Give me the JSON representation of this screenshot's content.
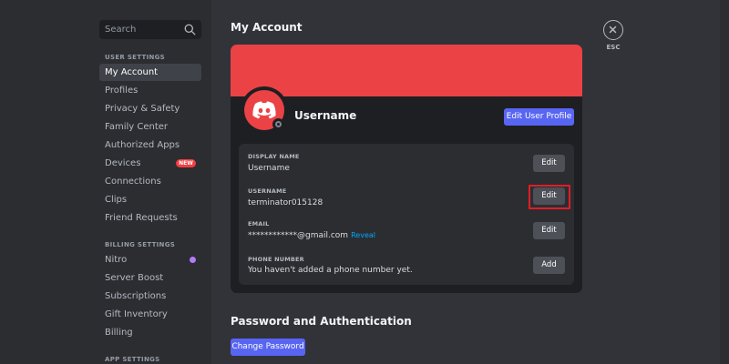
{
  "sidebar": {
    "search_placeholder": "Search",
    "sections": {
      "user_settings": "USER SETTINGS",
      "billing_settings": "BILLING SETTINGS",
      "app_settings": "APP SETTINGS"
    },
    "user_items": [
      {
        "label": "My Account",
        "active": true
      },
      {
        "label": "Profiles"
      },
      {
        "label": "Privacy & Safety"
      },
      {
        "label": "Family Center"
      },
      {
        "label": "Authorized Apps"
      },
      {
        "label": "Devices",
        "badge": "NEW"
      },
      {
        "label": "Connections"
      },
      {
        "label": "Clips"
      },
      {
        "label": "Friend Requests"
      }
    ],
    "billing_items": [
      {
        "label": "Nitro"
      },
      {
        "label": "Server Boost"
      },
      {
        "label": "Subscriptions"
      },
      {
        "label": "Gift Inventory"
      },
      {
        "label": "Billing"
      }
    ]
  },
  "main": {
    "title": "My Account",
    "esc_label": "ESC",
    "profile": {
      "name": "Username",
      "edit_button": "Edit User Profile",
      "banner_color": "#eb4245"
    },
    "fields": [
      {
        "label": "DISPLAY NAME",
        "value": "Username",
        "button": "Edit"
      },
      {
        "label": "USERNAME",
        "value": "terminator015128",
        "button": "Edit"
      },
      {
        "label": "EMAIL",
        "value": "************@gmail.com",
        "reveal": "Reveal",
        "button": "Edit"
      },
      {
        "label": "PHONE NUMBER",
        "value": "You haven't added a phone number yet.",
        "button": "Add"
      }
    ],
    "password_section": {
      "title": "Password and Authentication",
      "button": "Change Password"
    }
  },
  "colors": {
    "accent": "#5865f2",
    "danger": "#f23f43",
    "highlight_box": "#e01e26"
  }
}
